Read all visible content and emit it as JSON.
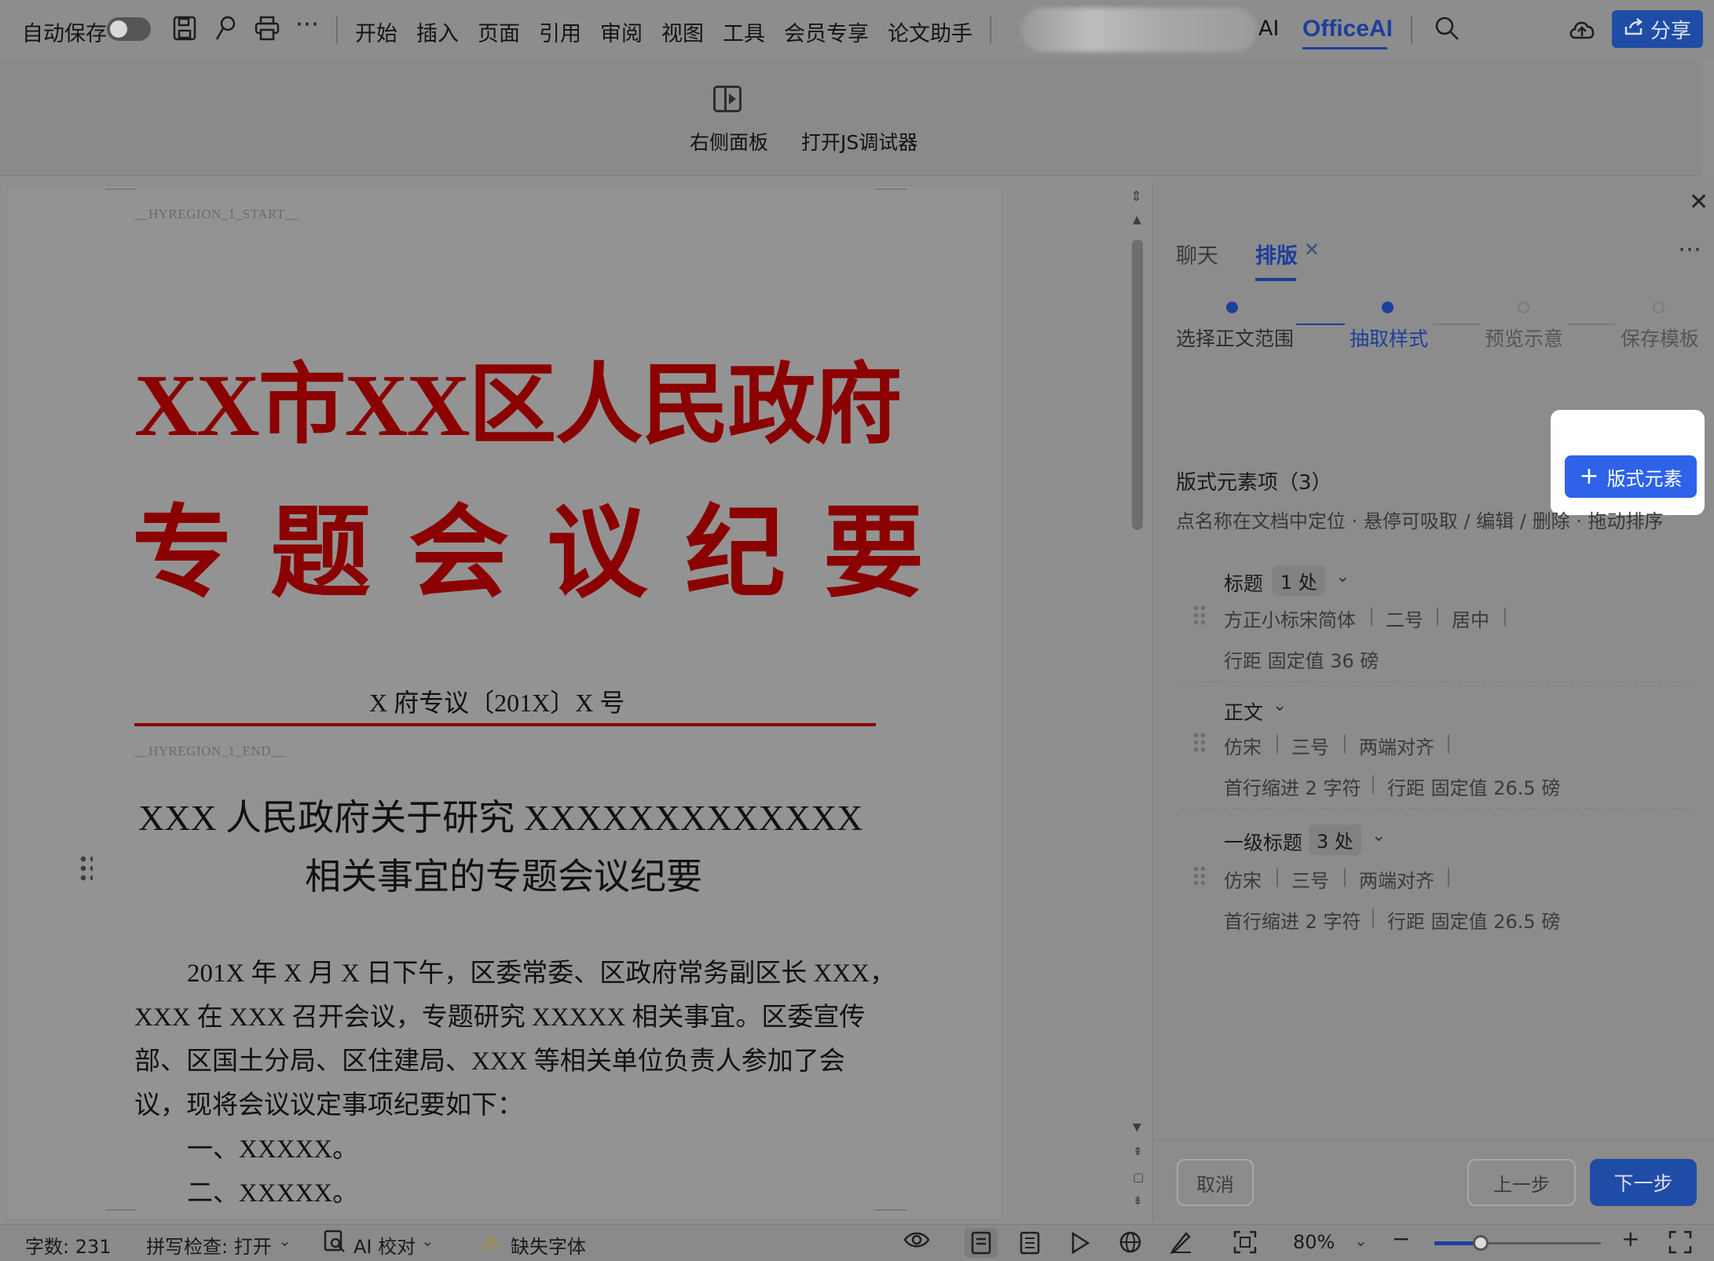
{
  "menubar": {
    "autosave_label": "自动保存",
    "menus": [
      "开始",
      "插入",
      "页面",
      "引用",
      "审阅",
      "视图",
      "工具",
      "会员专享",
      "论文助手"
    ],
    "ai_label": "AI",
    "officeai_label": "OfficeAI",
    "share_label": "分享"
  },
  "ribbon": {
    "right_panel_label": "右侧面板",
    "js_debugger_label": "打开JS调试器"
  },
  "document": {
    "region_start": "__HYREGION_1_START__",
    "region_end": "__HYREGION_1_END__",
    "header_line1": "XX市XX区人民政府",
    "header_line2": "专 题 会 议 纪 要",
    "doc_number": "X 府专议〔201X〕X 号",
    "title_line1": "XXX 人民政府关于研究 XXXXXXXXXXXXX",
    "title_line2": "相关事宜的专题会议纪要",
    "body_lines": [
      "201X 年 X 月 X 日下午，区委常委、区政府常务副区长 XXX，",
      "XXX 在 XXX 召开会议，专题研究 XXXXX 相关事宜。区委宣传",
      "部、区国土分局、区住建局、XXX 等相关单位负责人参加了会",
      "议，现将会议议定事项纪要如下："
    ],
    "list_items": [
      "一、XXXXX。",
      "二、XXXXX。"
    ]
  },
  "panel": {
    "tab_chat": "聊天",
    "tab_layout": "排版",
    "steps": [
      {
        "label": "选择正文范围",
        "state": "done"
      },
      {
        "label": "抽取样式",
        "state": "active"
      },
      {
        "label": "预览示意",
        "state": "pending"
      },
      {
        "label": "保存模板",
        "state": "pending"
      }
    ],
    "section_title": "版式元素项（3）",
    "add_button": "版式元素",
    "hint": "点名称在文档中定位 · 悬停可吸取 / 编辑 / 删除 · 拖动排序",
    "items": [
      {
        "name": "标题",
        "count": "1 处",
        "line1": [
          "方正小标宋简体",
          "二号",
          "居中"
        ],
        "line2": [
          "行距 固定值 36 磅"
        ]
      },
      {
        "name": "正文",
        "count": "",
        "line1": [
          "仿宋",
          "三号",
          "两端对齐"
        ],
        "line2": [
          "首行缩进 2 字符",
          "行距 固定值 26.5 磅"
        ]
      },
      {
        "name": "一级标题",
        "count": "3 处",
        "line1": [
          "仿宋",
          "三号",
          "两端对齐"
        ],
        "line2": [
          "首行缩进 2 字符",
          "行距 固定值 26.5 磅"
        ]
      }
    ],
    "cancel_label": "取消",
    "prev_label": "上一步",
    "next_label": "下一步"
  },
  "statusbar": {
    "word_count": "字数: 231",
    "spellcheck": "拼写检查: 打开",
    "ai_proof": "AI 校对",
    "missing_font": "缺失字体",
    "zoom_label": "80%",
    "zoom_fraction": 0.28
  },
  "colors": {
    "accent": "#1d3f9c",
    "button_blue": "#2e62e8",
    "red_header": "#8b0000"
  }
}
